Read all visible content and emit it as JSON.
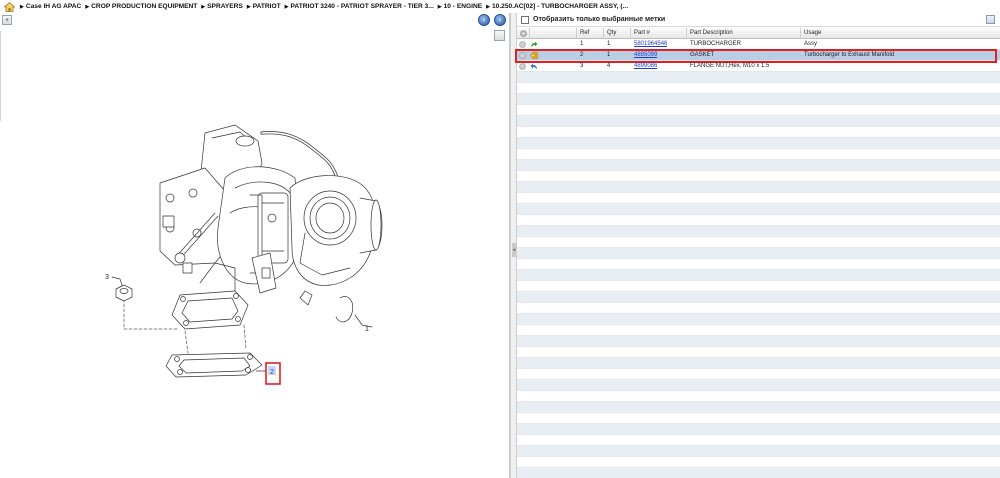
{
  "breadcrumb": {
    "items": [
      "Case IH AG APAC",
      "CROP PRODUCTION EQUIPMENT",
      "SPRAYERS",
      "PATRIOT",
      "PATRIOT 3240 - PATRIOT SPRAYER - TIER 3...",
      "10 - ENGINE",
      "10.250.AC[02] - TURBOCHARGER ASSY, (..."
    ]
  },
  "left_toolbar": {
    "expand_glyph": "+",
    "prev_glyph": "‹",
    "next_glyph": "›"
  },
  "diagram": {
    "callouts": [
      "3",
      "1",
      "2"
    ]
  },
  "parts_panel": {
    "filter_label": "Отобразить только выбранные метки",
    "columns": [
      "Ref",
      "Qty",
      "Part #",
      "Part Description",
      "Usage"
    ],
    "rows": [
      {
        "ref": "1",
        "qty": "1",
        "part": "5801964546",
        "description": "TURBOCHARGER",
        "usage": "Assy",
        "icon": "arrow-right-icon",
        "icon_color": "#3aa03a"
      },
      {
        "ref": "2",
        "qty": "1",
        "part": "4895099",
        "description": "GASKET",
        "usage": "Turbocharger to Exhaust Manifold",
        "icon": "tag-icon",
        "icon_color": "#e8a318"
      },
      {
        "ref": "3",
        "qty": "4",
        "part": "4899086",
        "description": "FLANGE NUT,Hex, M10 x 1.5",
        "usage": "",
        "icon": "arrow-back-icon",
        "icon_color": "#3a6fd0"
      }
    ]
  },
  "colors": {
    "selection_outline": "#e02020",
    "selected_row": "#b9cde4",
    "link": "#1a3fd0"
  }
}
